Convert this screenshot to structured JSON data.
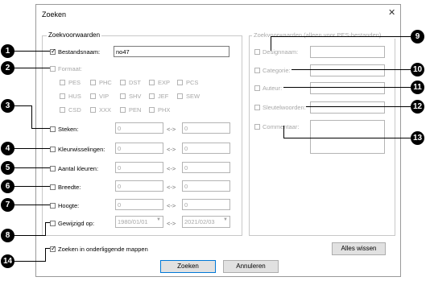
{
  "dialog": {
    "title": "Zoeken",
    "close_icon": "close-icon"
  },
  "left_group": {
    "legend": "Zoekvoorwaarden",
    "filename": {
      "label": "Bestandsnaam:",
      "checked": true,
      "value": "no47"
    },
    "format": {
      "label": "Formaat:",
      "row1": [
        "PES",
        "PHC",
        "DST",
        "EXP",
        "PCS"
      ],
      "row2": [
        "HUS",
        "VIP",
        "SHV",
        "JEF",
        "SEW"
      ],
      "row3": [
        "CSD",
        "XXX",
        "PEN",
        "PHX"
      ]
    },
    "stitches": {
      "label": "Steken:",
      "from": "0",
      "to": "0"
    },
    "color_changes": {
      "label": "Kleurwisselingen:",
      "from": "0",
      "to": "0"
    },
    "colors": {
      "label": "Aantal kleuren:",
      "from": "0",
      "to": "0"
    },
    "width": {
      "label": "Breedte:",
      "from": "0",
      "to": "0"
    },
    "height": {
      "label": "Hoogte:",
      "from": "0",
      "to": "0"
    },
    "modified": {
      "label": "Gewijzigd op:",
      "from": "1980/01/01",
      "to": "2021/02/03"
    },
    "range_sep": "<->"
  },
  "right_group": {
    "legend": "Zoekvoorwaarden (alleen voor PES-bestanden)",
    "design_name": "Designnaam:",
    "category": "Categorie:",
    "author": "Auteur:",
    "keywords": "Sleutelwoorden:",
    "comment": "Commentaar:"
  },
  "subfolders": {
    "label": "Zoeken in onderliggende mappen",
    "checked": true
  },
  "buttons": {
    "clear_all": "Alles wissen",
    "search": "Zoeken",
    "cancel": "Annuleren"
  },
  "callouts": [
    "1",
    "2",
    "3",
    "4",
    "5",
    "6",
    "7",
    "8",
    "9",
    "10",
    "11",
    "12",
    "13",
    "14"
  ]
}
